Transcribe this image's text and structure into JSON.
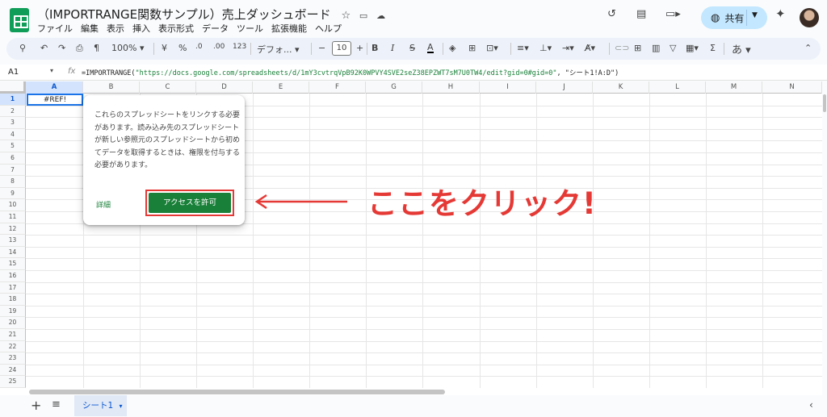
{
  "document": {
    "title": "（IMPORTRANGE関数サンプル）売上ダッシュボード",
    "menu": [
      "ファイル",
      "編集",
      "表示",
      "挿入",
      "表示形式",
      "データ",
      "ツール",
      "拡張機能",
      "ヘルプ"
    ]
  },
  "header": {
    "share_label": "共有"
  },
  "toolbar": {
    "zoom": "100%",
    "currency": "¥",
    "percent": "%",
    "decrease_decimal": ".0",
    "increase_decimal": ".00",
    "number_format": "123",
    "font": "デフォ...",
    "font_size": "10",
    "bold": "B",
    "italic": "I",
    "strikethrough": "S",
    "text_color": "A",
    "input_tools": "あ"
  },
  "formula_bar": {
    "cell_ref": "A1",
    "fx": "fx",
    "formula_prefix": "=IMPORTRANGE(",
    "formula_url": "\"https://docs.google.com/spreadsheets/d/1mY3cvtrqVpB92K0WPVY4SVE2seZ38EPZWT7sM7U0TW4/edit?gid=0#gid=0\"",
    "formula_suffix": ", \"シート1!A:D\")"
  },
  "grid": {
    "columns": [
      "A",
      "B",
      "C",
      "D",
      "E",
      "F",
      "G",
      "H",
      "I",
      "J",
      "K",
      "L",
      "M",
      "N"
    ],
    "rows": [
      "1",
      "2",
      "3",
      "4",
      "5",
      "6",
      "7",
      "8",
      "9",
      "10",
      "11",
      "12",
      "13",
      "14",
      "15",
      "16",
      "17",
      "18",
      "19",
      "20",
      "21",
      "22",
      "23",
      "24",
      "25"
    ],
    "cell_a1": "#REF!"
  },
  "popup": {
    "message": "これらのスプレッドシートをリンクする必要があります。読み込み先のスプレッドシートが新しい参照元のスプレッドシートから初めてデータを取得するときは、権限を付与する必要があります。",
    "details_link": "詳細",
    "allow_button": "アクセスを許可"
  },
  "annotation": {
    "text": "ここをクリック!",
    "color": "#e53935"
  },
  "sheets": {
    "active_tab": "シート1"
  },
  "colors": {
    "accent": "#188038",
    "selection": "#1a73e8",
    "share_bg": "#c2e7ff"
  }
}
